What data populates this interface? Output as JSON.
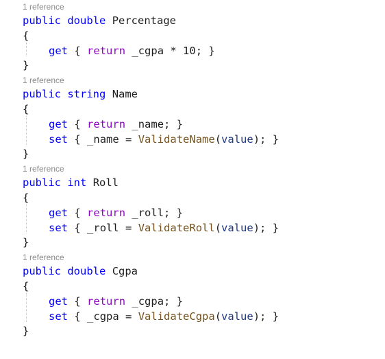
{
  "members": [
    {
      "codelens": "1 reference",
      "modifier": "public",
      "type": "double",
      "name": "Percentage",
      "open_brace": "{",
      "close_brace": "}",
      "get": {
        "kw": "get",
        "open": "{",
        "ret": "return",
        "expr": "_cgpa * 10;",
        "close": "}"
      }
    },
    {
      "codelens": "1 reference",
      "modifier": "public",
      "type": "string",
      "name": "Name",
      "open_brace": "{",
      "close_brace": "}",
      "get": {
        "kw": "get",
        "open": "{",
        "ret": "return",
        "expr": "_name;",
        "close": "}"
      },
      "set": {
        "kw": "set",
        "open": "{",
        "field": "_name =",
        "method": "ValidateName",
        "lparen": "(",
        "param": "value",
        "rparen": ");",
        "close": "}"
      }
    },
    {
      "codelens": "1 reference",
      "modifier": "public",
      "type": "int",
      "name": "Roll",
      "open_brace": "{",
      "close_brace": "}",
      "get": {
        "kw": "get",
        "open": "{",
        "ret": "return",
        "expr": "_roll;",
        "close": "}"
      },
      "set": {
        "kw": "set",
        "open": "{",
        "field": "_roll =",
        "method": "ValidateRoll",
        "lparen": "(",
        "param": "value",
        "rparen": ");",
        "close": "}"
      }
    },
    {
      "codelens": "1 reference",
      "modifier": "public",
      "type": "double",
      "name": "Cgpa",
      "open_brace": "{",
      "close_brace": "}",
      "get": {
        "kw": "get",
        "open": "{",
        "ret": "return",
        "expr": "_cgpa;",
        "close": "}"
      },
      "set": {
        "kw": "set",
        "open": "{",
        "field": "_cgpa =",
        "method": "ValidateCgpa",
        "lparen": "(",
        "param": "value",
        "rparen": ");",
        "close": "}"
      }
    }
  ],
  "colors": {
    "keyword": "#0000ff",
    "control_keyword": "#8f08c4",
    "method": "#74531f",
    "parameter": "#1f377f",
    "codelens": "#8a8a8a"
  }
}
